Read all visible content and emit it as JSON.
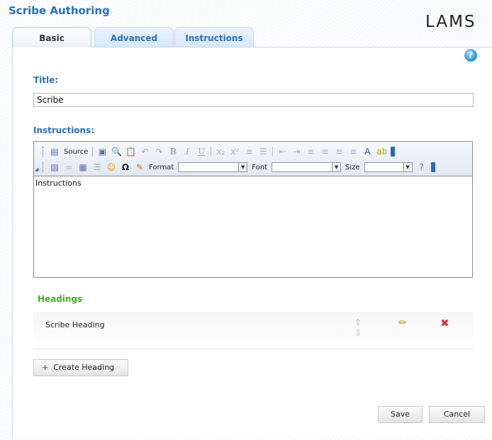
{
  "app": {
    "title": "Scribe Authoring",
    "logo_text": "LAMS"
  },
  "tabs": [
    {
      "label": "Basic",
      "active": true
    },
    {
      "label": "Advanced",
      "active": false
    },
    {
      "label": "Instructions",
      "active": false
    }
  ],
  "help": {
    "icon": "question-icon",
    "glyph": "?"
  },
  "form": {
    "title_label": "Title:",
    "title_value": "Scribe",
    "instructions_label": "Instructions:",
    "instructions_value": "Instructions"
  },
  "editor_toolbar": {
    "source_label": "Source",
    "format_label": "Format",
    "font_label": "Font",
    "size_label": "Size"
  },
  "headings": {
    "section_label": "Headings",
    "items": [
      {
        "text": "Scribe Heading"
      }
    ],
    "create_label": "Create Heading"
  },
  "actions": {
    "save_label": "Save",
    "cancel_label": "Cancel"
  },
  "colors": {
    "accent": "#2b6fb6",
    "headings": "#4aaa27",
    "delete": "#d7313a"
  }
}
